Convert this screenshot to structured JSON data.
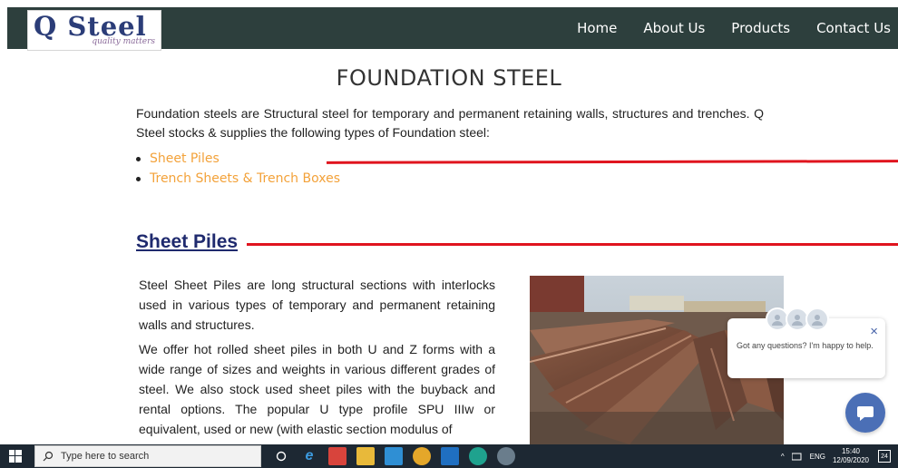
{
  "navbar": {
    "logo_text": "Q Steel",
    "logo_tagline": "quality matters",
    "links": [
      "Home",
      "About Us",
      "Products",
      "Contact Us"
    ]
  },
  "page_title": "FOUNDATION STEEL",
  "intro_text": "Foundation steels are Structural steel for temporary and permanent retaining walls, structures and trenches. Q Steel stocks & supplies the following types of Foundation steel:",
  "product_links": [
    "Sheet Piles",
    "Trench Sheets & Trench Boxes"
  ],
  "section": {
    "heading": "Sheet Piles",
    "paragraph1": "Steel Sheet Piles are long structural sections with interlocks used in various types of temporary and permanent retaining walls and structures.",
    "paragraph2": "We offer hot rolled sheet piles in both U and Z forms with a wide range of sizes and weights in various different grades of steel. We also stock used sheet piles with the buyback and rental options. The popular U type profile SPU IIIw or equivalent, used or new (with elastic section modulus of"
  },
  "chat": {
    "message": "Got any questions? I'm happy to help.",
    "close_label": "×"
  },
  "taskbar": {
    "search_placeholder": "Type here to search",
    "language": "ENG",
    "time": "15:40",
    "date": "12/09/2020",
    "notifications": "24"
  },
  "colors": {
    "navbar": "#2d3f3d",
    "link_orange": "#f3a23a",
    "heading_navy": "#1f2a6e",
    "accent_red": "#e0141e",
    "chat_blue": "#4b6fb6"
  }
}
